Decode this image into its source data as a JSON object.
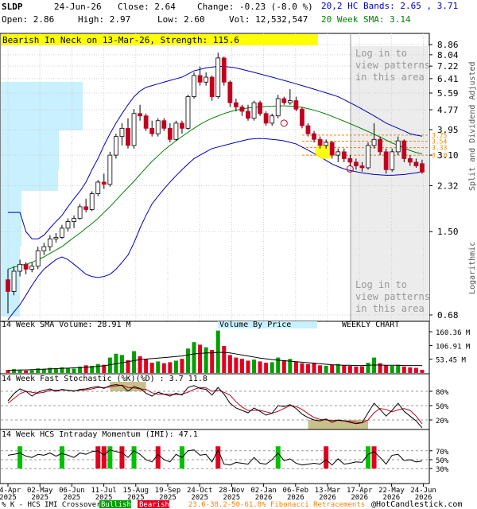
{
  "header": {
    "symbol": "SLDP",
    "date": "24-Jun-26",
    "close_label": "Close: 2.64",
    "change_label": "Change: -0.23 (-8.0 %)",
    "open_label": "Open: 2.86",
    "high_label": "High: 2.97",
    "low_label": "Low: 2.60",
    "vol_label": "Vol: 12,532,547",
    "bands_label": "20,2 HC Bands: 2.65 , 3.71",
    "sma_label": "20 Week SMA: 3.14"
  },
  "pattern_banner": "Bearish In Neck on 13-Mar-26, Strength: 115.6",
  "login_text_1": [
    "Log in to",
    "view patterns",
    "in this area"
  ],
  "login_text_2": [
    "Log in to",
    "view patterns",
    "in this area"
  ],
  "right_axis_label": "Split and Dividend Adjusted",
  "log_label": "Logarithmic",
  "labels": {
    "volume_sma": "14 Week SMA Volume: 28.91 M",
    "volume_by_price": "Volume By Price",
    "weekly_chart": "WEEKLY CHART",
    "stoch": "14 Week Fast Stochastic (%K)(%D) : 3.7  11.8",
    "imi": "14 Week HCS Intraday Momentum (IMI): 47.1"
  },
  "footer": {
    "legend_k": "% K - HCS IMI Crossover,",
    "bullish": "Bullish",
    "bearish": "Bearish",
    "fib": "23.6-38.2-50-61.8% Fibonacci Retracements",
    "copyright": "@HotCandlestick.com"
  },
  "colors": {
    "up": "#00a000",
    "down": "#c00020",
    "bands": "#0000c0",
    "sma": "#008000",
    "vbp": "#c8f0ff",
    "banner": "#ffff00",
    "fib": "#ff8000"
  },
  "chart_data": {
    "type": "candlestick",
    "scale": "log",
    "price_ticks": [
      "8.86",
      "8.04",
      "7.22",
      "6.41",
      "5.59",
      "4.77",
      "3.95",
      "3.10",
      "2.32",
      "1.50",
      "0.68"
    ],
    "fib_levels": [
      "3.75",
      "3.54",
      "3.33",
      "3.10"
    ],
    "volume_ticks": [
      "160.36 M",
      "106.91 M",
      "53.45 M"
    ],
    "stoch_ticks": [
      "80%",
      "50%",
      "20%"
    ],
    "imi_ticks": [
      "70%",
      "50%",
      "30%"
    ],
    "x_ticks": [
      [
        "04-Apr",
        "2025"
      ],
      [
        "02-May",
        "2025"
      ],
      [
        "06-Jun",
        "2025"
      ],
      [
        "11-Jul",
        "2025"
      ],
      [
        "15-Aug",
        "2025"
      ],
      [
        "19-Sep",
        "2025"
      ],
      [
        "24-Oct",
        "2025"
      ],
      [
        "28-Nov",
        "2025"
      ],
      [
        "02-Jan",
        "2026"
      ],
      [
        "06-Feb",
        "2026"
      ],
      [
        "13-Mar",
        "2026"
      ],
      [
        "17-Apr",
        "2026"
      ],
      [
        "22-May",
        "2026"
      ],
      [
        "24-Jun",
        "2026"
      ]
    ],
    "candles": [
      [
        0.95,
        1.05,
        0.69,
        0.85
      ],
      [
        0.85,
        1.08,
        0.82,
        1.03
      ],
      [
        1.03,
        1.15,
        0.98,
        1.1
      ],
      [
        1.1,
        1.12,
        1.0,
        1.05
      ],
      [
        1.05,
        1.12,
        1.02,
        1.08
      ],
      [
        1.08,
        1.3,
        1.05,
        1.25
      ],
      [
        1.25,
        1.35,
        1.2,
        1.3
      ],
      [
        1.3,
        1.45,
        1.25,
        1.4
      ],
      [
        1.4,
        1.48,
        1.35,
        1.42
      ],
      [
        1.42,
        1.6,
        1.4,
        1.55
      ],
      [
        1.55,
        1.7,
        1.5,
        1.65
      ],
      [
        1.65,
        1.75,
        1.55,
        1.7
      ],
      [
        1.7,
        1.95,
        1.68,
        1.9
      ],
      [
        1.9,
        2.05,
        1.8,
        1.85
      ],
      [
        1.85,
        2.2,
        1.82,
        2.15
      ],
      [
        2.15,
        2.45,
        2.1,
        2.4
      ],
      [
        2.4,
        2.6,
        2.25,
        2.35
      ],
      [
        2.35,
        3.2,
        2.3,
        3.1
      ],
      [
        3.1,
        3.8,
        3.0,
        3.7
      ],
      [
        3.7,
        4.2,
        3.4,
        4.0
      ],
      [
        4.0,
        4.4,
        3.3,
        3.4
      ],
      [
        3.4,
        4.8,
        3.3,
        4.6
      ],
      [
        4.6,
        5.0,
        4.3,
        4.5
      ],
      [
        4.5,
        4.6,
        3.9,
        4.0
      ],
      [
        4.0,
        4.3,
        3.7,
        3.8
      ],
      [
        3.8,
        4.4,
        3.7,
        4.3
      ],
      [
        4.3,
        4.4,
        3.9,
        4.0
      ],
      [
        4.0,
        4.2,
        3.5,
        3.6
      ],
      [
        3.6,
        4.3,
        3.55,
        4.2
      ],
      [
        4.2,
        4.3,
        3.8,
        4.0
      ],
      [
        4.0,
        5.5,
        3.95,
        5.4
      ],
      [
        5.4,
        6.8,
        5.3,
        6.6
      ],
      [
        6.6,
        7.2,
        6.0,
        6.2
      ],
      [
        6.2,
        6.8,
        6.0,
        6.5
      ],
      [
        6.5,
        6.6,
        5.2,
        5.4
      ],
      [
        5.4,
        8.2,
        5.3,
        7.8
      ],
      [
        7.8,
        7.9,
        6.0,
        6.2
      ],
      [
        6.2,
        6.3,
        4.9,
        5.1
      ],
      [
        5.1,
        5.3,
        4.7,
        4.9
      ],
      [
        4.9,
        5.0,
        4.5,
        4.7
      ],
      [
        4.7,
        5.0,
        4.3,
        4.4
      ],
      [
        4.4,
        5.2,
        4.3,
        5.1
      ],
      [
        5.1,
        5.2,
        4.5,
        4.6
      ],
      [
        4.6,
        4.7,
        4.1,
        4.2
      ],
      [
        4.2,
        4.6,
        4.1,
        4.5
      ],
      [
        4.5,
        5.5,
        4.4,
        5.3
      ],
      [
        5.3,
        5.4,
        5.0,
        5.1
      ],
      [
        5.1,
        5.8,
        5.0,
        5.2
      ],
      [
        5.2,
        5.4,
        4.7,
        4.8
      ],
      [
        4.8,
        4.9,
        4.0,
        4.1
      ],
      [
        4.1,
        4.2,
        3.7,
        3.8
      ],
      [
        3.8,
        3.9,
        3.5,
        3.6
      ],
      [
        3.6,
        3.7,
        3.3,
        3.4
      ],
      [
        3.4,
        3.6,
        3.3,
        3.5
      ],
      [
        3.5,
        3.55,
        3.0,
        3.1
      ],
      [
        3.1,
        3.3,
        2.9,
        3.2
      ],
      [
        3.2,
        3.3,
        2.9,
        3.0
      ],
      [
        3.0,
        3.1,
        2.8,
        2.9
      ],
      [
        2.9,
        3.0,
        2.7,
        2.8
      ],
      [
        2.8,
        2.9,
        2.65,
        2.75
      ],
      [
        2.75,
        3.5,
        2.7,
        3.4
      ],
      [
        3.4,
        4.2,
        3.3,
        3.6
      ],
      [
        3.6,
        3.7,
        3.1,
        3.2
      ],
      [
        3.2,
        3.3,
        2.6,
        2.7
      ],
      [
        2.7,
        3.3,
        2.65,
        3.2
      ],
      [
        3.2,
        3.7,
        3.1,
        3.55
      ],
      [
        3.55,
        3.6,
        2.9,
        3.0
      ],
      [
        3.0,
        3.1,
        2.8,
        2.9
      ],
      [
        2.9,
        3.0,
        2.75,
        2.8
      ],
      [
        2.86,
        2.97,
        2.6,
        2.64
      ]
    ],
    "upper_band": [
      1.8,
      1.8,
      1.8,
      1.5,
      1.4,
      1.4,
      1.45,
      1.55,
      1.65,
      1.75,
      1.9,
      2.05,
      2.2,
      2.4,
      2.7,
      3.0,
      3.4,
      3.8,
      4.2,
      4.6,
      5.0,
      5.4,
      5.7,
      5.9,
      6.0,
      6.1,
      6.2,
      6.3,
      6.4,
      6.5,
      6.7,
      6.9,
      7.0,
      7.1,
      7.15,
      7.2,
      7.2,
      7.15,
      7.1,
      7.0,
      6.9,
      6.8,
      6.7,
      6.6,
      6.5,
      6.4,
      6.3,
      6.2,
      6.1,
      6.0,
      5.9,
      5.8,
      5.7,
      5.6,
      5.5,
      5.4,
      5.25,
      5.1,
      4.95,
      4.8,
      4.65,
      4.5,
      4.35,
      4.2,
      4.1,
      4.0,
      3.9,
      3.8,
      3.75,
      3.71
    ],
    "lower_band": [
      0.65,
      0.7,
      0.75,
      0.82,
      0.9,
      0.98,
      1.05,
      1.1,
      1.15,
      1.18,
      1.15,
      1.1,
      1.05,
      1.0,
      0.98,
      0.97,
      0.98,
      1.0,
      1.05,
      1.12,
      1.2,
      1.35,
      1.55,
      1.75,
      1.95,
      2.1,
      2.25,
      2.4,
      2.55,
      2.7,
      2.85,
      3.0,
      3.1,
      3.2,
      3.3,
      3.35,
      3.4,
      3.45,
      3.5,
      3.55,
      3.6,
      3.62,
      3.63,
      3.62,
      3.6,
      3.58,
      3.55,
      3.5,
      3.45,
      3.35,
      3.25,
      3.15,
      3.05,
      2.95,
      2.85,
      2.78,
      2.72,
      2.68,
      2.65,
      2.62,
      2.6,
      2.58,
      2.57,
      2.56,
      2.56,
      2.57,
      2.58,
      2.6,
      2.62,
      2.65
    ],
    "sma": [
      1.05,
      1.07,
      1.09,
      1.1,
      1.12,
      1.15,
      1.18,
      1.22,
      1.26,
      1.3,
      1.36,
      1.42,
      1.48,
      1.55,
      1.62,
      1.7,
      1.8,
      1.9,
      2.02,
      2.15,
      2.28,
      2.42,
      2.58,
      2.75,
      2.92,
      3.08,
      3.25,
      3.4,
      3.55,
      3.7,
      3.85,
      4.0,
      4.15,
      4.28,
      4.4,
      4.5,
      4.6,
      4.68,
      4.75,
      4.8,
      4.85,
      4.88,
      4.9,
      4.92,
      4.93,
      4.95,
      4.95,
      4.94,
      4.92,
      4.88,
      4.82,
      4.75,
      4.67,
      4.58,
      4.48,
      4.38,
      4.28,
      4.18,
      4.08,
      3.98,
      3.88,
      3.78,
      3.68,
      3.58,
      3.48,
      3.4,
      3.32,
      3.24,
      3.18,
      3.14
    ],
    "volume_m": [
      12,
      15,
      10,
      9,
      11,
      18,
      14,
      20,
      16,
      22,
      19,
      17,
      25,
      30,
      28,
      35,
      32,
      60,
      75,
      70,
      50,
      85,
      65,
      55,
      40,
      45,
      38,
      42,
      48,
      55,
      95,
      120,
      110,
      100,
      90,
      165,
      105,
      70,
      60,
      55,
      48,
      52,
      45,
      40,
      42,
      60,
      50,
      55,
      45,
      38,
      35,
      40,
      30,
      28,
      32,
      35,
      30,
      28,
      25,
      26,
      40,
      60,
      38,
      30,
      28,
      32,
      25,
      22,
      20,
      12.5
    ],
    "volume_sma_m": [
      10,
      11,
      12,
      12,
      13,
      14,
      15,
      16,
      17,
      18,
      19,
      20,
      21,
      22,
      24,
      26,
      28,
      32,
      36,
      40,
      44,
      48,
      52,
      54,
      56,
      58,
      60,
      62,
      64,
      66,
      70,
      74,
      76,
      78,
      78,
      80,
      80,
      78,
      74,
      70,
      66,
      62,
      58,
      55,
      52,
      50,
      48,
      46,
      44,
      42,
      40,
      38,
      36,
      34,
      32,
      31,
      30,
      30,
      29,
      29,
      30,
      31,
      31,
      30,
      30,
      30,
      29,
      29,
      29,
      28.91
    ],
    "stoch_k": [
      60,
      75,
      85,
      80,
      70,
      78,
      82,
      85,
      80,
      84,
      82,
      80,
      84,
      85,
      88,
      90,
      86,
      92,
      94,
      92,
      80,
      90,
      86,
      76,
      70,
      78,
      74,
      70,
      76,
      72,
      88,
      92,
      86,
      84,
      72,
      88,
      74,
      55,
      45,
      40,
      35,
      45,
      38,
      30,
      34,
      50,
      48,
      52,
      44,
      32,
      25,
      20,
      18,
      22,
      15,
      20,
      18,
      15,
      12,
      14,
      35,
      55,
      42,
      28,
      40,
      55,
      38,
      28,
      18,
      3.7
    ],
    "stoch_d": [
      55,
      65,
      75,
      80,
      78,
      76,
      78,
      82,
      82,
      83,
      82,
      81,
      82,
      83,
      85,
      88,
      88,
      89,
      91,
      93,
      88,
      87,
      85,
      84,
      77,
      74,
      74,
      74,
      73,
      74,
      78,
      84,
      88,
      87,
      80,
      82,
      78,
      72,
      58,
      47,
      40,
      40,
      40,
      37,
      34,
      38,
      44,
      50,
      48,
      42,
      33,
      25,
      21,
      20,
      19,
      19,
      18,
      17,
      15,
      14,
      20,
      35,
      44,
      42,
      37,
      41,
      44,
      40,
      28,
      11.8
    ],
    "stoch_shading_bands": [
      [
        17,
        23
      ],
      [
        50,
        60
      ]
    ],
    "imi": [
      60,
      62,
      65,
      58,
      55,
      62,
      60,
      65,
      58,
      64,
      60,
      55,
      65,
      62,
      68,
      70,
      60,
      72,
      68,
      66,
      55,
      70,
      62,
      50,
      45,
      62,
      50,
      45,
      62,
      55,
      70,
      72,
      60,
      62,
      45,
      72,
      40,
      38,
      44,
      42,
      40,
      55,
      42,
      40,
      50,
      65,
      48,
      52,
      42,
      38,
      40,
      42,
      40,
      50,
      38,
      52,
      40,
      42,
      45,
      44,
      62,
      68,
      55,
      40,
      60,
      62,
      48,
      50,
      45,
      47.1
    ],
    "imi_bull": [
      2,
      9,
      17,
      21,
      29,
      45,
      60
    ],
    "imi_bear": [
      15,
      16,
      19,
      25,
      35,
      53,
      61
    ]
  }
}
